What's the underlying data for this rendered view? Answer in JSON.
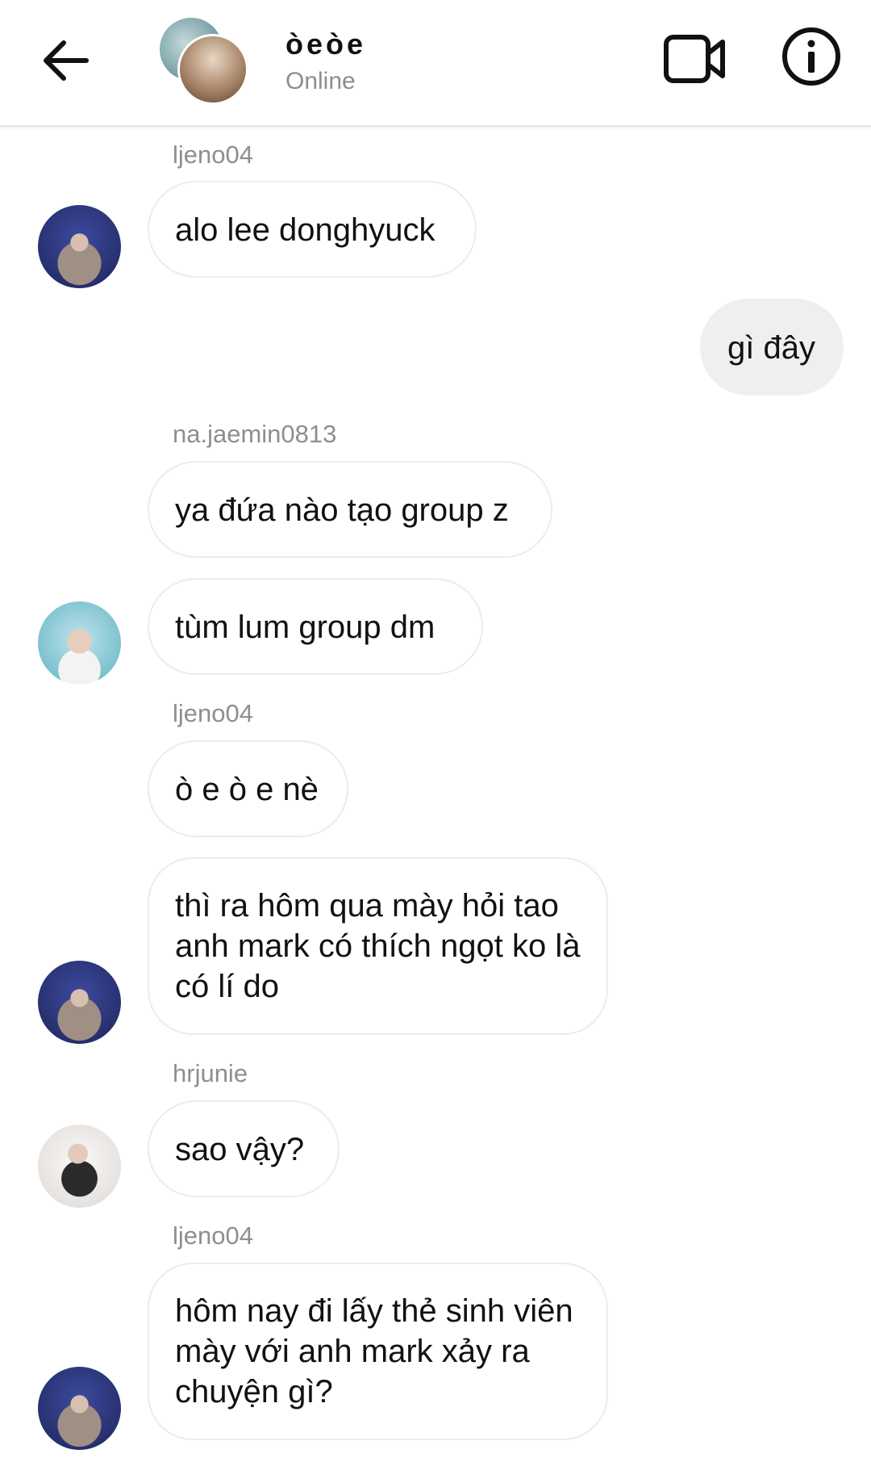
{
  "header": {
    "title": "òeòe",
    "status": "Online",
    "icons": {
      "back": "arrow-left-icon",
      "video": "video-camera-icon",
      "info": "info-circle-icon"
    }
  },
  "messages": [
    {
      "sender": "ljeno04",
      "text": "alo lee donghyuck"
    },
    {
      "sender": "me",
      "text": "gì đây"
    },
    {
      "sender": "na.jaemin0813",
      "text": "ya đứa nào tạo group z"
    },
    {
      "sender": "na.jaemin0813",
      "text": "tùm lum group dm"
    },
    {
      "sender": "ljeno04",
      "text": "ò e ò e nè"
    },
    {
      "sender": "ljeno04",
      "text": "thì ra hôm qua mày hỏi tao anh mark có thích ngọt ko là có lí do"
    },
    {
      "sender": "hrjunie",
      "text": "sao vậy?"
    },
    {
      "sender": "ljeno04",
      "text": "hôm nay đi lấy thẻ sinh viên mày với anh mark xảy ra chuyện gì?"
    }
  ]
}
